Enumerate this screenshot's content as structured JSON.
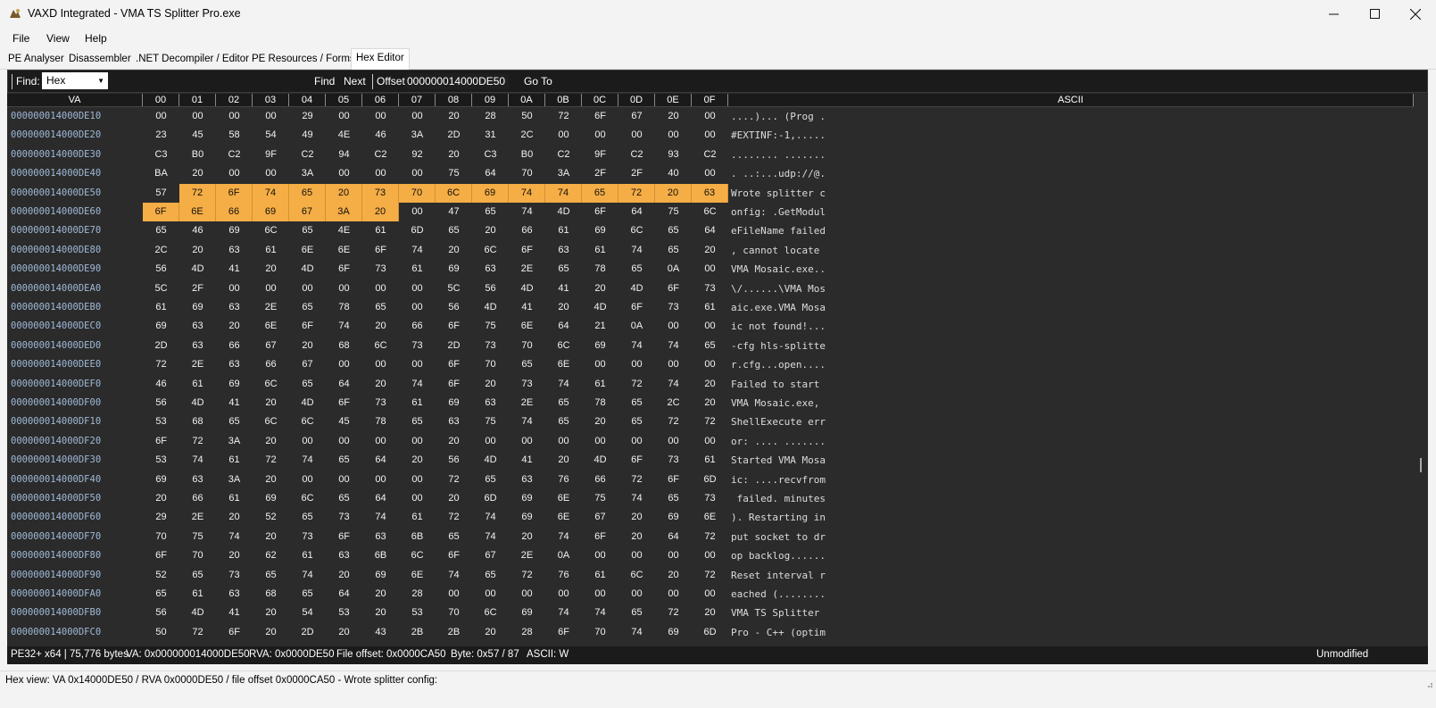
{
  "window": {
    "title": "VAXD Integrated - VMA TS Splitter Pro.exe",
    "minimize_icon": "minimize-icon",
    "maximize_icon": "maximize-icon",
    "close_icon": "close-icon"
  },
  "menu": [
    "File",
    "View",
    "Help"
  ],
  "tabs": [
    {
      "label": "PE Analyser",
      "active": false
    },
    {
      "label": "Disassembler",
      "active": false
    },
    {
      "label": ".NET Decompiler / Editor",
      "active": false
    },
    {
      "label": "PE Resources / Forms",
      "active": false
    },
    {
      "label": "Hex Editor",
      "active": true
    }
  ],
  "toolbar": {
    "find_label": "Find:",
    "find_mode": "Hex",
    "find_value": "",
    "find_button": "Find",
    "next_button": "Next",
    "offset_label": "Offset:",
    "offset_value": "000000014000DE50",
    "goto_button": "Go To"
  },
  "grid": {
    "headers": [
      "VA",
      "00",
      "01",
      "02",
      "03",
      "04",
      "05",
      "06",
      "07",
      "08",
      "09",
      "0A",
      "0B",
      "0C",
      "0D",
      "0E",
      "0F",
      "ASCII"
    ],
    "rows": [
      {
        "va": "000000014000DE10",
        "bytes": [
          "00",
          "00",
          "00",
          "00",
          "29",
          "00",
          "00",
          "00",
          "20",
          "28",
          "50",
          "72",
          "6F",
          "67",
          "20",
          "00"
        ],
        "ascii": "....)... (Prog ."
      },
      {
        "va": "000000014000DE20",
        "bytes": [
          "23",
          "45",
          "58",
          "54",
          "49",
          "4E",
          "46",
          "3A",
          "2D",
          "31",
          "2C",
          "00",
          "00",
          "00",
          "00",
          "00"
        ],
        "ascii": "#EXTINF:-1,....."
      },
      {
        "va": "000000014000DE30",
        "bytes": [
          "C3",
          "B0",
          "C2",
          "9F",
          "C2",
          "94",
          "C2",
          "92",
          "20",
          "C3",
          "B0",
          "C2",
          "9F",
          "C2",
          "93",
          "C2"
        ],
        "ascii": "........ ......."
      },
      {
        "va": "000000014000DE40",
        "bytes": [
          "BA",
          "20",
          "00",
          "00",
          "3A",
          "00",
          "00",
          "00",
          "75",
          "64",
          "70",
          "3A",
          "2F",
          "2F",
          "40",
          "00"
        ],
        "ascii": ". ..:...udp://@."
      },
      {
        "va": "000000014000DE50",
        "bytes": [
          "57",
          "72",
          "6F",
          "74",
          "65",
          "20",
          "73",
          "70",
          "6C",
          "69",
          "74",
          "74",
          "65",
          "72",
          "20",
          "63"
        ],
        "ascii": "Wrote splitter c",
        "hl_from": 1,
        "hl_to": 15
      },
      {
        "va": "000000014000DE60",
        "bytes": [
          "6F",
          "6E",
          "66",
          "69",
          "67",
          "3A",
          "20",
          "00",
          "47",
          "65",
          "74",
          "4D",
          "6F",
          "64",
          "75",
          "6C"
        ],
        "ascii": "onfig: .GetModul",
        "hl_from": 0,
        "hl_to": 6
      },
      {
        "va": "000000014000DE70",
        "bytes": [
          "65",
          "46",
          "69",
          "6C",
          "65",
          "4E",
          "61",
          "6D",
          "65",
          "20",
          "66",
          "61",
          "69",
          "6C",
          "65",
          "64"
        ],
        "ascii": "eFileName failed"
      },
      {
        "va": "000000014000DE80",
        "bytes": [
          "2C",
          "20",
          "63",
          "61",
          "6E",
          "6E",
          "6F",
          "74",
          "20",
          "6C",
          "6F",
          "63",
          "61",
          "74",
          "65",
          "20"
        ],
        "ascii": ", cannot locate "
      },
      {
        "va": "000000014000DE90",
        "bytes": [
          "56",
          "4D",
          "41",
          "20",
          "4D",
          "6F",
          "73",
          "61",
          "69",
          "63",
          "2E",
          "65",
          "78",
          "65",
          "0A",
          "00"
        ],
        "ascii": "VMA Mosaic.exe.."
      },
      {
        "va": "000000014000DEA0",
        "bytes": [
          "5C",
          "2F",
          "00",
          "00",
          "00",
          "00",
          "00",
          "00",
          "5C",
          "56",
          "4D",
          "41",
          "20",
          "4D",
          "6F",
          "73"
        ],
        "ascii": "\\/......\\VMA Mos"
      },
      {
        "va": "000000014000DEB0",
        "bytes": [
          "61",
          "69",
          "63",
          "2E",
          "65",
          "78",
          "65",
          "00",
          "56",
          "4D",
          "41",
          "20",
          "4D",
          "6F",
          "73",
          "61"
        ],
        "ascii": "aic.exe.VMA Mosa"
      },
      {
        "va": "000000014000DEC0",
        "bytes": [
          "69",
          "63",
          "20",
          "6E",
          "6F",
          "74",
          "20",
          "66",
          "6F",
          "75",
          "6E",
          "64",
          "21",
          "0A",
          "00",
          "00"
        ],
        "ascii": "ic not found!..."
      },
      {
        "va": "000000014000DED0",
        "bytes": [
          "2D",
          "63",
          "66",
          "67",
          "20",
          "68",
          "6C",
          "73",
          "2D",
          "73",
          "70",
          "6C",
          "69",
          "74",
          "74",
          "65"
        ],
        "ascii": "-cfg hls-splitte"
      },
      {
        "va": "000000014000DEE0",
        "bytes": [
          "72",
          "2E",
          "63",
          "66",
          "67",
          "00",
          "00",
          "00",
          "6F",
          "70",
          "65",
          "6E",
          "00",
          "00",
          "00",
          "00"
        ],
        "ascii": "r.cfg...open...."
      },
      {
        "va": "000000014000DEF0",
        "bytes": [
          "46",
          "61",
          "69",
          "6C",
          "65",
          "64",
          "20",
          "74",
          "6F",
          "20",
          "73",
          "74",
          "61",
          "72",
          "74",
          "20"
        ],
        "ascii": "Failed to start "
      },
      {
        "va": "000000014000DF00",
        "bytes": [
          "56",
          "4D",
          "41",
          "20",
          "4D",
          "6F",
          "73",
          "61",
          "69",
          "63",
          "2E",
          "65",
          "78",
          "65",
          "2C",
          "20"
        ],
        "ascii": "VMA Mosaic.exe, "
      },
      {
        "va": "000000014000DF10",
        "bytes": [
          "53",
          "68",
          "65",
          "6C",
          "6C",
          "45",
          "78",
          "65",
          "63",
          "75",
          "74",
          "65",
          "20",
          "65",
          "72",
          "72"
        ],
        "ascii": "ShellExecute err"
      },
      {
        "va": "000000014000DF20",
        "bytes": [
          "6F",
          "72",
          "3A",
          "20",
          "00",
          "00",
          "00",
          "00",
          "20",
          "00",
          "00",
          "00",
          "00",
          "00",
          "00",
          "00"
        ],
        "ascii": "or: .... ......."
      },
      {
        "va": "000000014000DF30",
        "bytes": [
          "53",
          "74",
          "61",
          "72",
          "74",
          "65",
          "64",
          "20",
          "56",
          "4D",
          "41",
          "20",
          "4D",
          "6F",
          "73",
          "61"
        ],
        "ascii": "Started VMA Mosa"
      },
      {
        "va": "000000014000DF40",
        "bytes": [
          "69",
          "63",
          "3A",
          "20",
          "00",
          "00",
          "00",
          "00",
          "72",
          "65",
          "63",
          "76",
          "66",
          "72",
          "6F",
          "6D"
        ],
        "ascii": "ic: ....recvfrom"
      },
      {
        "va": "000000014000DF50",
        "bytes": [
          "20",
          "66",
          "61",
          "69",
          "6C",
          "65",
          "64",
          "00",
          "20",
          "6D",
          "69",
          "6E",
          "75",
          "74",
          "65",
          "73"
        ],
        "ascii": " failed. minutes"
      },
      {
        "va": "000000014000DF60",
        "bytes": [
          "29",
          "2E",
          "20",
          "52",
          "65",
          "73",
          "74",
          "61",
          "72",
          "74",
          "69",
          "6E",
          "67",
          "20",
          "69",
          "6E"
        ],
        "ascii": "). Restarting in"
      },
      {
        "va": "000000014000DF70",
        "bytes": [
          "70",
          "75",
          "74",
          "20",
          "73",
          "6F",
          "63",
          "6B",
          "65",
          "74",
          "20",
          "74",
          "6F",
          "20",
          "64",
          "72"
        ],
        "ascii": "put socket to dr"
      },
      {
        "va": "000000014000DF80",
        "bytes": [
          "6F",
          "70",
          "20",
          "62",
          "61",
          "63",
          "6B",
          "6C",
          "6F",
          "67",
          "2E",
          "0A",
          "00",
          "00",
          "00",
          "00"
        ],
        "ascii": "op backlog......"
      },
      {
        "va": "000000014000DF90",
        "bytes": [
          "52",
          "65",
          "73",
          "65",
          "74",
          "20",
          "69",
          "6E",
          "74",
          "65",
          "72",
          "76",
          "61",
          "6C",
          "20",
          "72"
        ],
        "ascii": "Reset interval r"
      },
      {
        "va": "000000014000DFA0",
        "bytes": [
          "65",
          "61",
          "63",
          "68",
          "65",
          "64",
          "20",
          "28",
          "00",
          "00",
          "00",
          "00",
          "00",
          "00",
          "00",
          "00"
        ],
        "ascii": "eached (........"
      },
      {
        "va": "000000014000DFB0",
        "bytes": [
          "56",
          "4D",
          "41",
          "20",
          "54",
          "53",
          "20",
          "53",
          "70",
          "6C",
          "69",
          "74",
          "74",
          "65",
          "72",
          "20"
        ],
        "ascii": "VMA TS Splitter "
      },
      {
        "va": "000000014000DFC0",
        "bytes": [
          "50",
          "72",
          "6F",
          "20",
          "2D",
          "20",
          "43",
          "2B",
          "2B",
          "20",
          "28",
          "6F",
          "70",
          "74",
          "69",
          "6D"
        ],
        "ascii": "Pro - C++ (optim"
      }
    ]
  },
  "status": {
    "pe_info": "PE32+ x64 | 75,776 bytes",
    "va": "VA: 0x000000014000DE50",
    "rva": "RVA: 0x0000DE50",
    "file_offset": "File offset: 0x0000CA50",
    "byte": "Byte: 0x57 / 87",
    "ascii": "ASCII: W",
    "modified": "Unmodified"
  },
  "footer_text": "Hex view: VA 0x14000DE50 / RVA 0x0000DE50 / file offset 0x0000CA50 - Wrote splitter config:",
  "colors": {
    "highlight": "#f5ad45",
    "va_text": "#9fb9d8",
    "grid_bg": "#2b2b2b"
  }
}
